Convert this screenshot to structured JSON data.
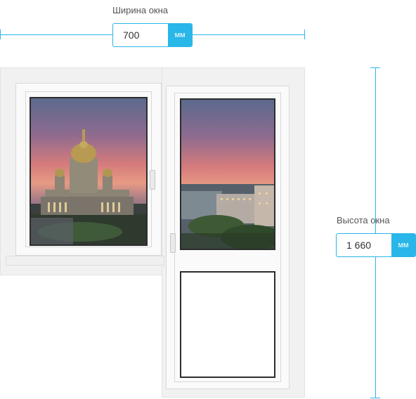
{
  "width_field": {
    "label": "Ширина окна",
    "value": "700",
    "unit": "мм"
  },
  "height_field": {
    "label": "Высота окна",
    "value": "1 660",
    "unit": "мм"
  },
  "colors": {
    "accent": "#29b6e8",
    "frame": "#f3f3f3",
    "glass_border": "#2d2d2d"
  }
}
